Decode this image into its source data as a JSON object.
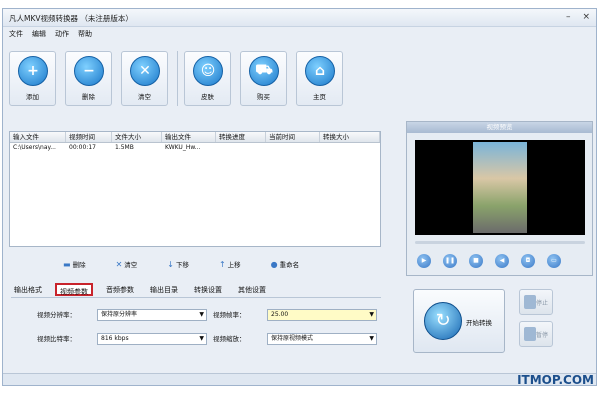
{
  "window": {
    "title": "凡人MKV视频转换器 （未注册版本）"
  },
  "menu": [
    "文件",
    "编辑",
    "动作",
    "帮助"
  ],
  "toolbar": [
    {
      "label": "添加",
      "icon": "plus-icon"
    },
    {
      "label": "删除",
      "icon": "minus-icon"
    },
    {
      "label": "清空",
      "icon": "clear-icon"
    },
    {
      "label": "皮肤",
      "icon": "face-icon"
    },
    {
      "label": "购买",
      "icon": "cart-icon"
    },
    {
      "label": "主页",
      "icon": "home-icon"
    }
  ],
  "filelist": {
    "headers": [
      "输入文件",
      "视频时间",
      "文件大小",
      "输出文件",
      "转换进度",
      "当前时间",
      "转换大小"
    ],
    "rows": [
      [
        "C:\\Users\\nay...",
        "00:00:17",
        "1.5MB",
        "KWKU_Hw...",
        "",
        "",
        ""
      ]
    ]
  },
  "list_actions": [
    "删除",
    "清空",
    "下移",
    "上移",
    "重命名"
  ],
  "tabs": [
    "输出格式",
    "视频参数",
    "音频参数",
    "输出目录",
    "转换设置",
    "其他设置"
  ],
  "params": {
    "resolution_label": "视频分辨率：",
    "resolution_value": "保持原分辨率",
    "framerate_label": "视频帧率：",
    "framerate_value": "25.00",
    "bitrate_label": "视频比特率：",
    "bitrate_value": "816 kbps",
    "scale_label": "视频缩放：",
    "scale_value": "保持原视频模式"
  },
  "preview": {
    "title": "视频预览"
  },
  "convert": {
    "label": "开始转换"
  },
  "side_buttons": [
    "停止",
    "暂停"
  ],
  "watermark": "ITMOP.COM"
}
